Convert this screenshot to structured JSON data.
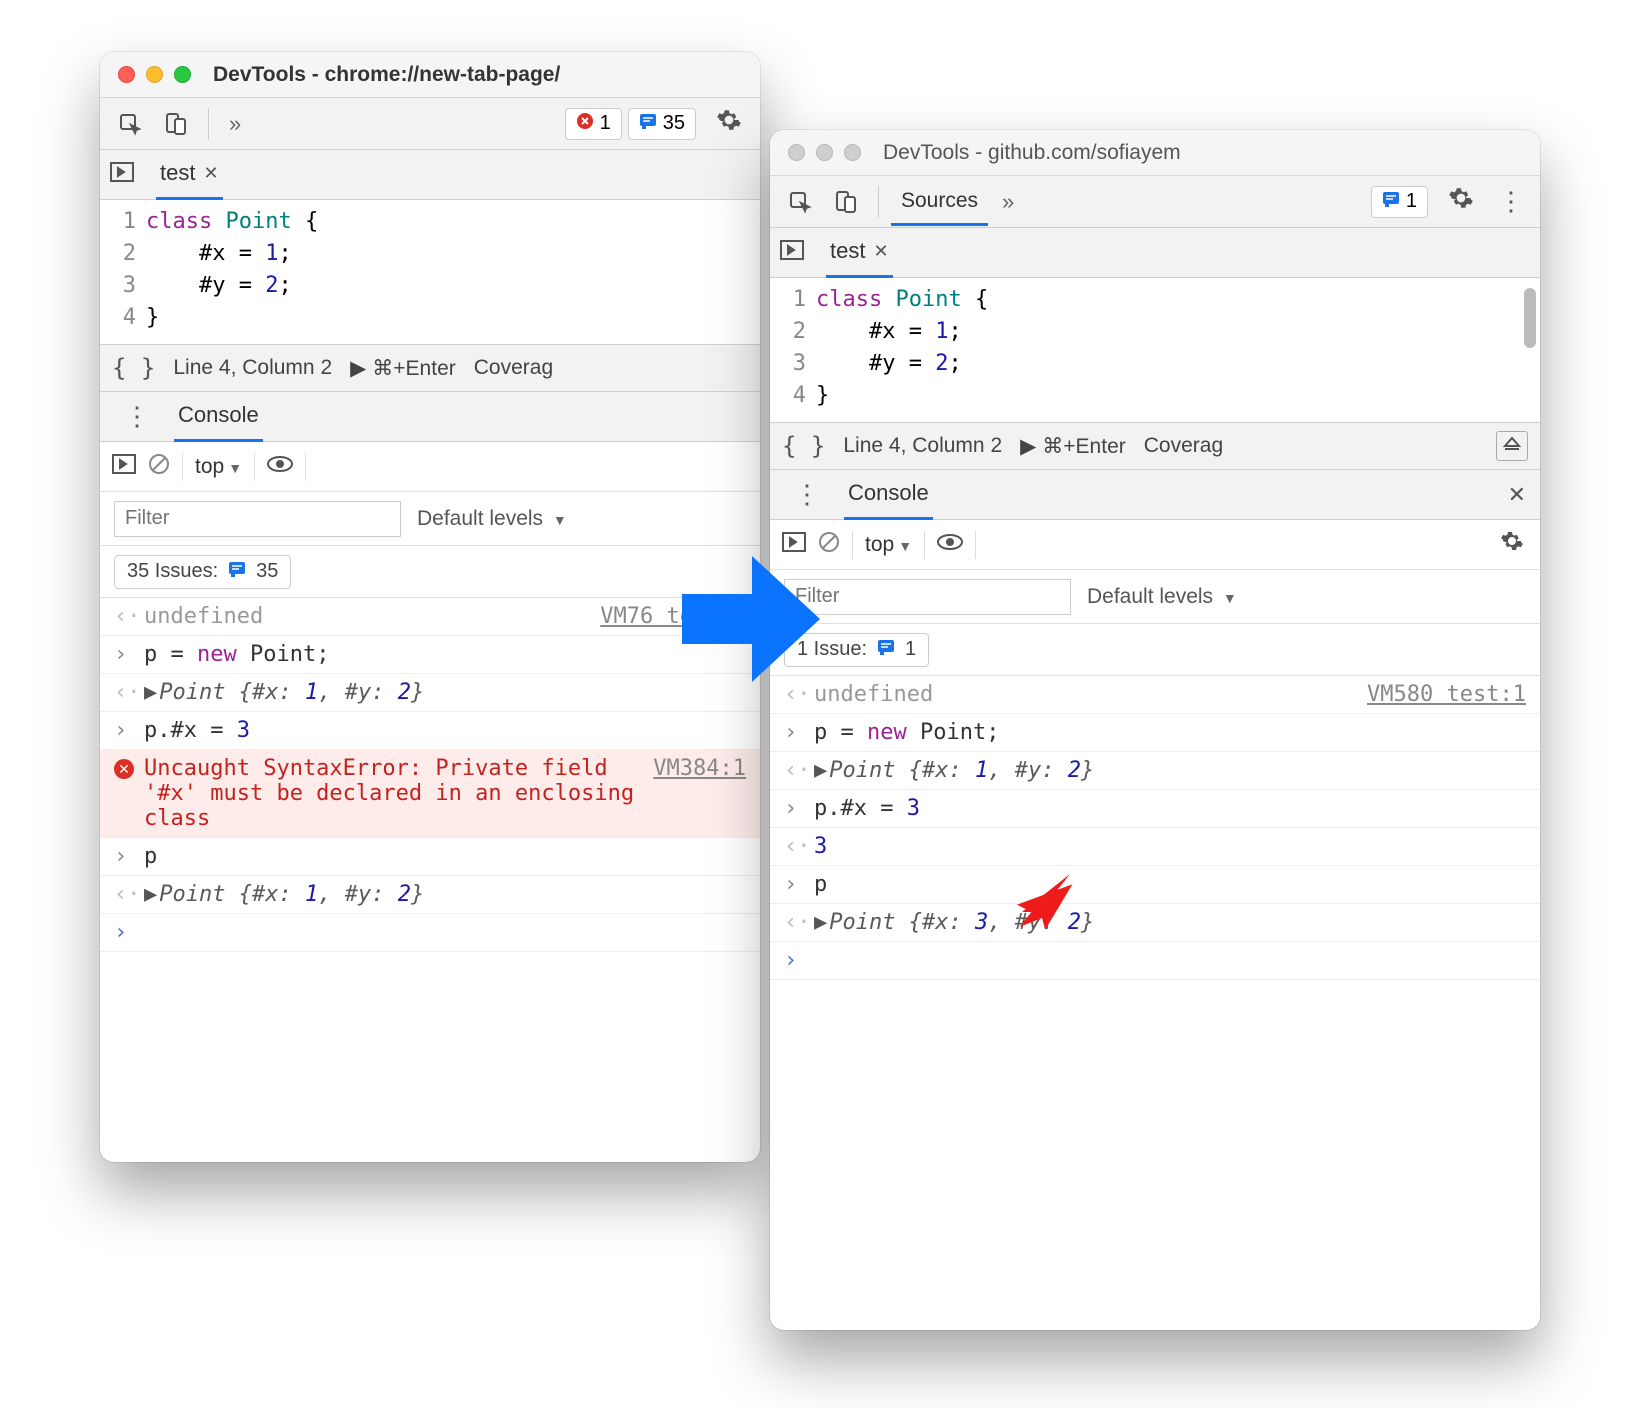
{
  "colors": {
    "accent": "#1a73e8",
    "error": "#d93025"
  },
  "left": {
    "title_prefix": "DevTools - ",
    "title_url": "chrome://new-tab-page/",
    "toolbar": {
      "errors": "1",
      "messages": "35"
    },
    "file_tab": "test",
    "code_lines": [
      "class Point {",
      "    #x = 1;",
      "    #y = 2;",
      "}"
    ],
    "status": {
      "cursor": "Line 4, Column 2",
      "run_hint": "⌘+Enter",
      "coverage": "Coverag"
    },
    "console_label": "Console",
    "context": "top",
    "filter_placeholder": "Filter",
    "levels": "Default levels",
    "issues_label": "35 Issues:",
    "issues_count": "35",
    "log": [
      {
        "type": "out",
        "text": "undefined",
        "src": "VM76 test:1"
      },
      {
        "type": "in",
        "text": "p = new Point;"
      },
      {
        "type": "out",
        "obj": "Point {#x: 1, #y: 2}"
      },
      {
        "type": "in",
        "text": "p.#x = 3"
      },
      {
        "type": "err",
        "text": "Uncaught SyntaxError: Private field '#x' must be declared in an enclosing class",
        "src": "VM384:1"
      },
      {
        "type": "in",
        "text": "p"
      },
      {
        "type": "out",
        "obj": "Point {#x: 1, #y: 2}"
      },
      {
        "type": "prompt"
      }
    ]
  },
  "right": {
    "title_prefix": "DevTools - ",
    "title_url": "github.com/sofiayem",
    "toolbar": {
      "sources_label": "Sources",
      "messages": "1"
    },
    "file_tab": "test",
    "code_lines": [
      "class Point {",
      "    #x = 1;",
      "    #y = 2;",
      "}"
    ],
    "status": {
      "cursor": "Line 4, Column 2",
      "run_hint": "⌘+Enter",
      "coverage": "Coverag"
    },
    "console_label": "Console",
    "context": "top",
    "filter_placeholder": "Filter",
    "levels": "Default levels",
    "issues_label": "1 Issue:",
    "issues_count": "1",
    "log": [
      {
        "type": "out",
        "text": "undefined",
        "src": "VM580 test:1"
      },
      {
        "type": "in",
        "text": "p = new Point;"
      },
      {
        "type": "out",
        "obj": "Point {#x: 1, #y: 2}"
      },
      {
        "type": "in",
        "text": "p.#x = 3"
      },
      {
        "type": "out",
        "text": "3"
      },
      {
        "type": "in",
        "text": "p"
      },
      {
        "type": "out",
        "obj": "Point {#x: 3, #y: 2}"
      },
      {
        "type": "prompt"
      }
    ]
  }
}
